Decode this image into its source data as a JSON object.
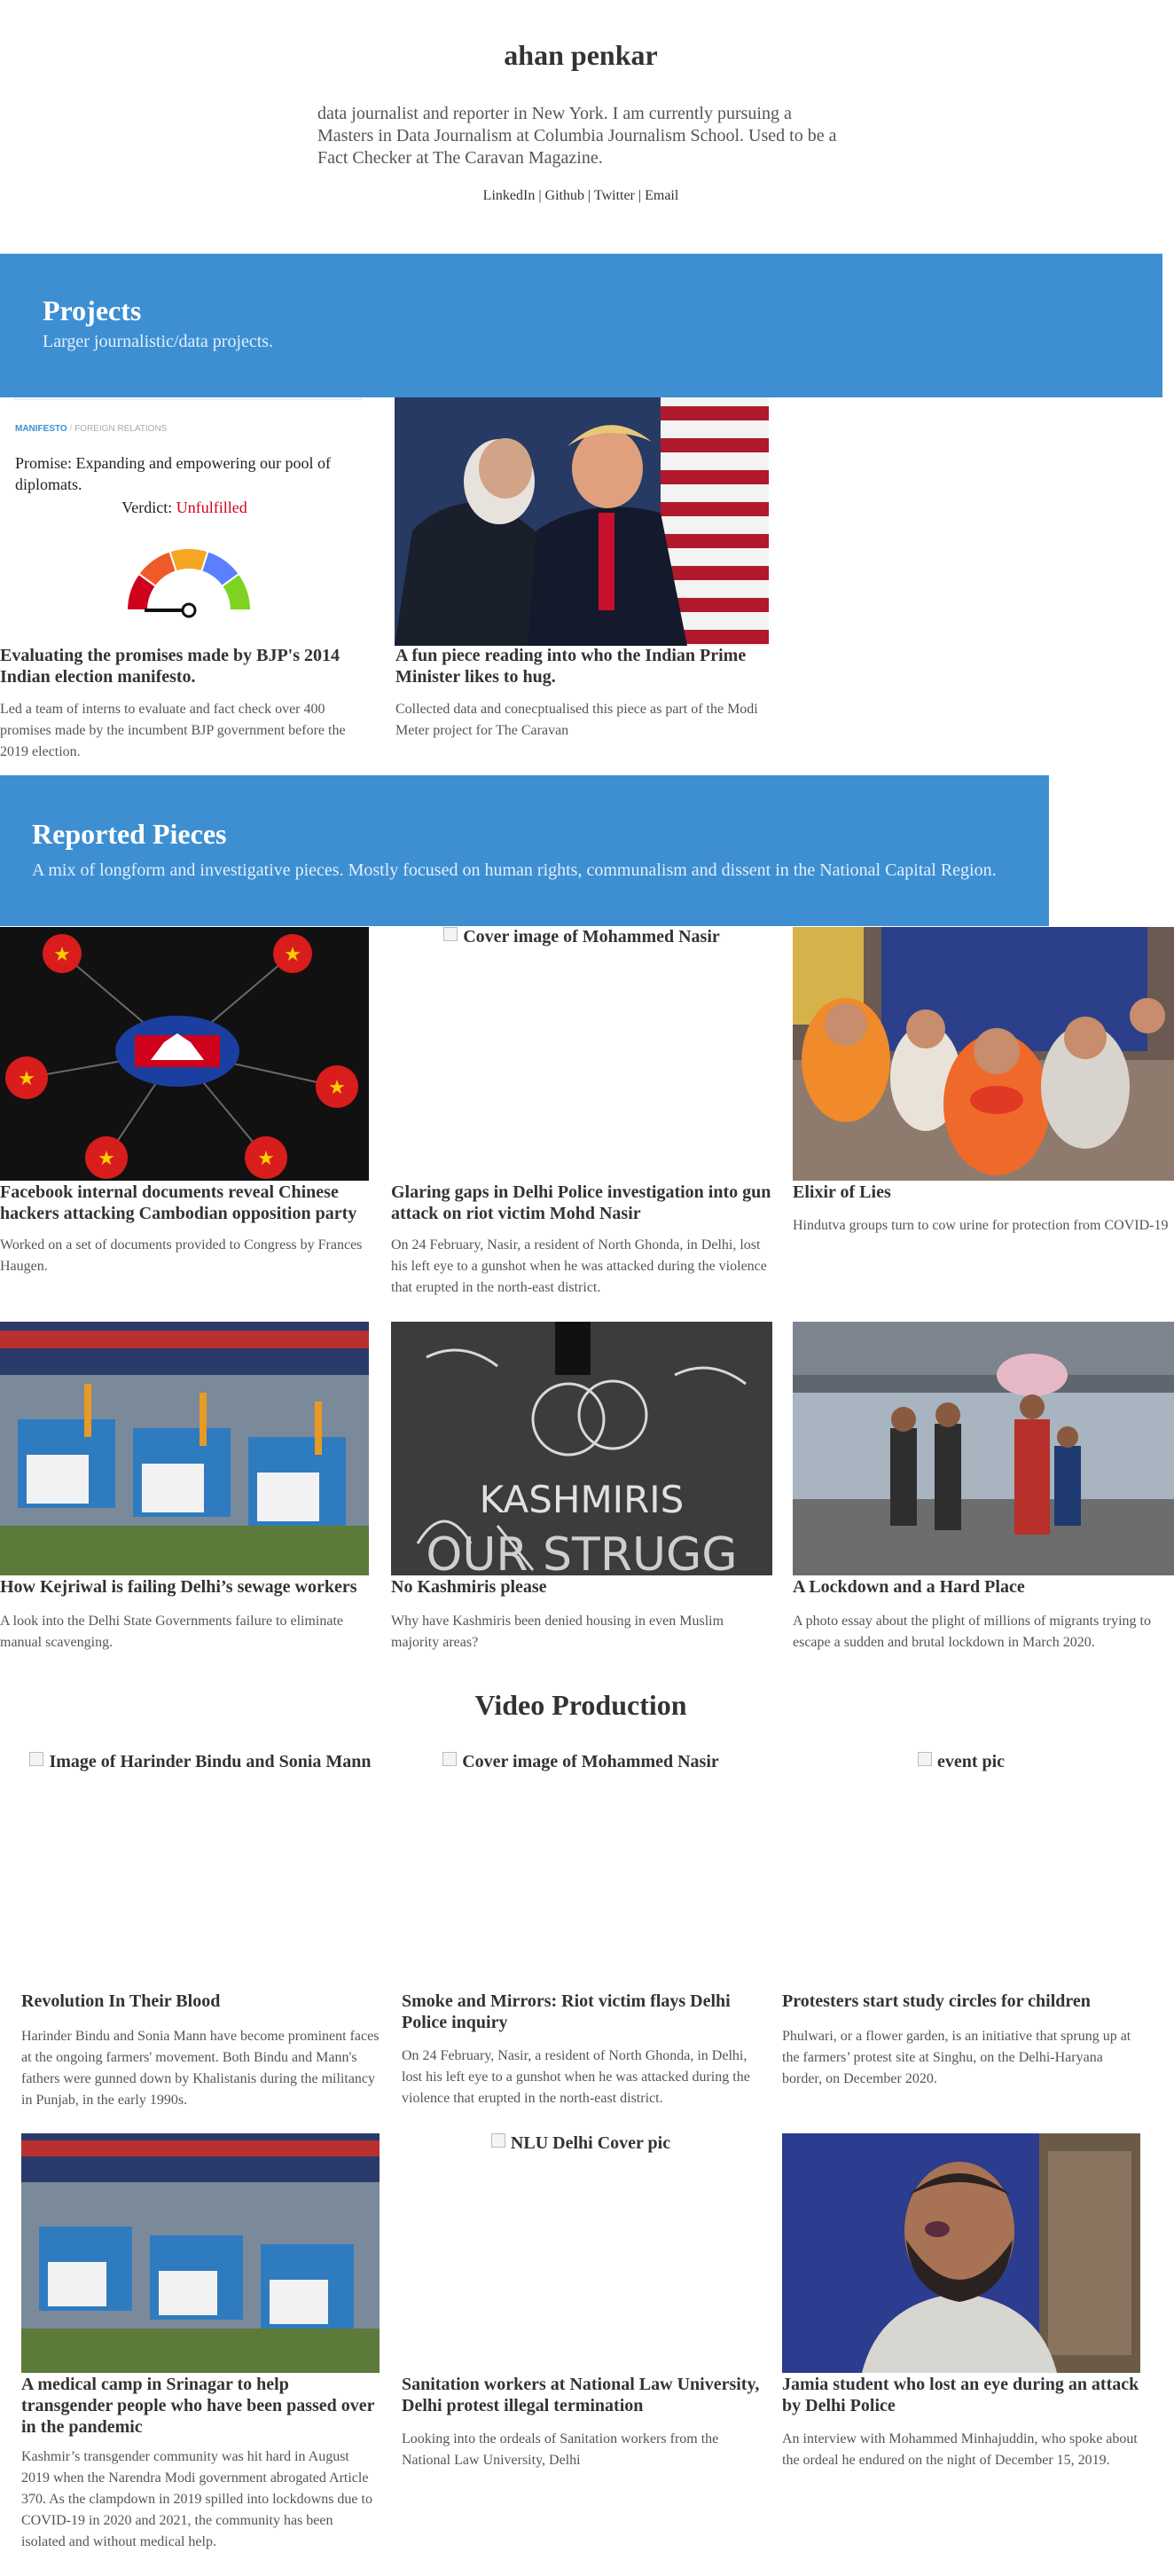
{
  "header": {
    "name": "ahan penkar",
    "bio": "data journalist and reporter in New York. I am currently pursuing a Masters in Data Journalism at Columbia Journalism School. Used to be a Fact Checker at The Caravan Magazine.",
    "links": [
      "LinkedIn",
      "Github",
      "Twitter",
      "Email"
    ],
    "separator": "|"
  },
  "projects": {
    "title": "Projects",
    "subtitle": "Larger journalistic/data projects.",
    "gauge_thumb": {
      "tag_main": "MANIFESTO",
      "tag_sep": "/",
      "tag_sub": "FOREIGN RELATIONS",
      "promise": "Promise: Expanding and empowering our pool of diplomats.",
      "verdict_label": "Verdict:",
      "verdict_value": "Unfulfilled",
      "gauge_level": 0.0,
      "colors": [
        "#d0021b",
        "#f05a28",
        "#f5a623",
        "#5b7fff",
        "#7ed321"
      ]
    },
    "items": [
      {
        "title": "Evaluating the promises made by BJP's 2014 Indian election manifesto.",
        "desc": "Led a team of interns to evaluate and fact check over 400 promises made by the incumbent BJP government before the 2019 election."
      },
      {
        "title": "A fun piece reading into who the Indian Prime Minister likes to hug.",
        "desc": "Collected data and conecptualised this piece as part of the Modi Meter project for The Caravan"
      }
    ]
  },
  "reported": {
    "title": "Reported Pieces",
    "subtitle": "A mix of longform and investigative pieces. Mostly focused on human rights, communalism and dissent in the National Capital Region.",
    "items": [
      {
        "title": "Facebook internal documents reveal Chinese hackers attacking Cambodian opposition party",
        "desc": "Worked on a set of documents provided to Congress by Frances Haugen."
      },
      {
        "img_alt": "Cover image of Mohammed Nasir",
        "title": "Glaring gaps in Delhi Police investigation into gun attack on riot victim Mohd Nasir",
        "desc": "On 24 February, Nasir, a resident of North Ghonda, in Delhi, lost his left eye to a gunshot when he was attacked during the violence that erupted in the north-east district."
      },
      {
        "title": "Elixir of Lies",
        "desc": "Hindutva groups turn to cow urine for protection from COVID-19"
      },
      {
        "title": "How Kejriwal is failing Delhi’s sewage workers",
        "desc": "A look into the Delhi State Governments failure to eliminate manual scavenging."
      },
      {
        "title": "No Kashmiris please",
        "desc": "Why have Kashmiris been denied housing in even Muslim majority areas?"
      },
      {
        "title": "A Lockdown and a Hard Place",
        "desc": "A photo essay about the plight of millions of migrants trying to escape a sudden and brutal lockdown in March 2020."
      }
    ]
  },
  "video": {
    "title": "Video Production",
    "items": [
      {
        "img_alt": "Image of Harinder Bindu and Sonia Mann",
        "title": "Revolution In Their Blood",
        "desc": "Harinder Bindu and Sonia Mann have become prominent faces at the ongoing farmers' movement. Both Bindu and Mann's fathers were gunned down by Khalistanis during the militancy in Punjab, in the early 1990s."
      },
      {
        "img_alt": "Cover image of Mohammed Nasir",
        "title": "Smoke and Mirrors: Riot victim flays Delhi Police inquiry",
        "desc": "On 24 February, Nasir, a resident of North Ghonda, in Delhi, lost his left eye to a gunshot when he was attacked during the violence that erupted in the north-east district."
      },
      {
        "img_alt": "event pic",
        "title": "Protesters start study circles for children",
        "desc": "Phulwari, or a flower garden, is an initiative that sprung up at the farmers’ protest site at Singhu, on the Delhi-Haryana border, on December 2020."
      },
      {
        "title": "A medical camp in Srinagar to help transgender people who have been passed over in the pandemic",
        "desc": "Kashmir’s transgender community was hit hard in August 2019 when the Narendra Modi government abrogated Article 370. As the clampdown in 2019 spilled into lockdowns due to COVID-19 in 2020 and 2021, the community has been isolated and without medical help."
      },
      {
        "img_alt": "NLU Delhi Cover pic",
        "title": "Sanitation workers at National Law University, Delhi protest illegal termination",
        "desc": "Looking into the ordeals of Sanitation workers from the National Law University, Delhi"
      },
      {
        "title": "Jamia student who lost an eye during an attack by Delhi Police",
        "desc": "An interview with Mohammed Minhajuddin, who spoke about the ordeal he endured on the night of December 15, 2019."
      }
    ]
  },
  "colors": {
    "banner": "#3d8fd2",
    "text": "#333333",
    "verdict": "#d0021b"
  }
}
